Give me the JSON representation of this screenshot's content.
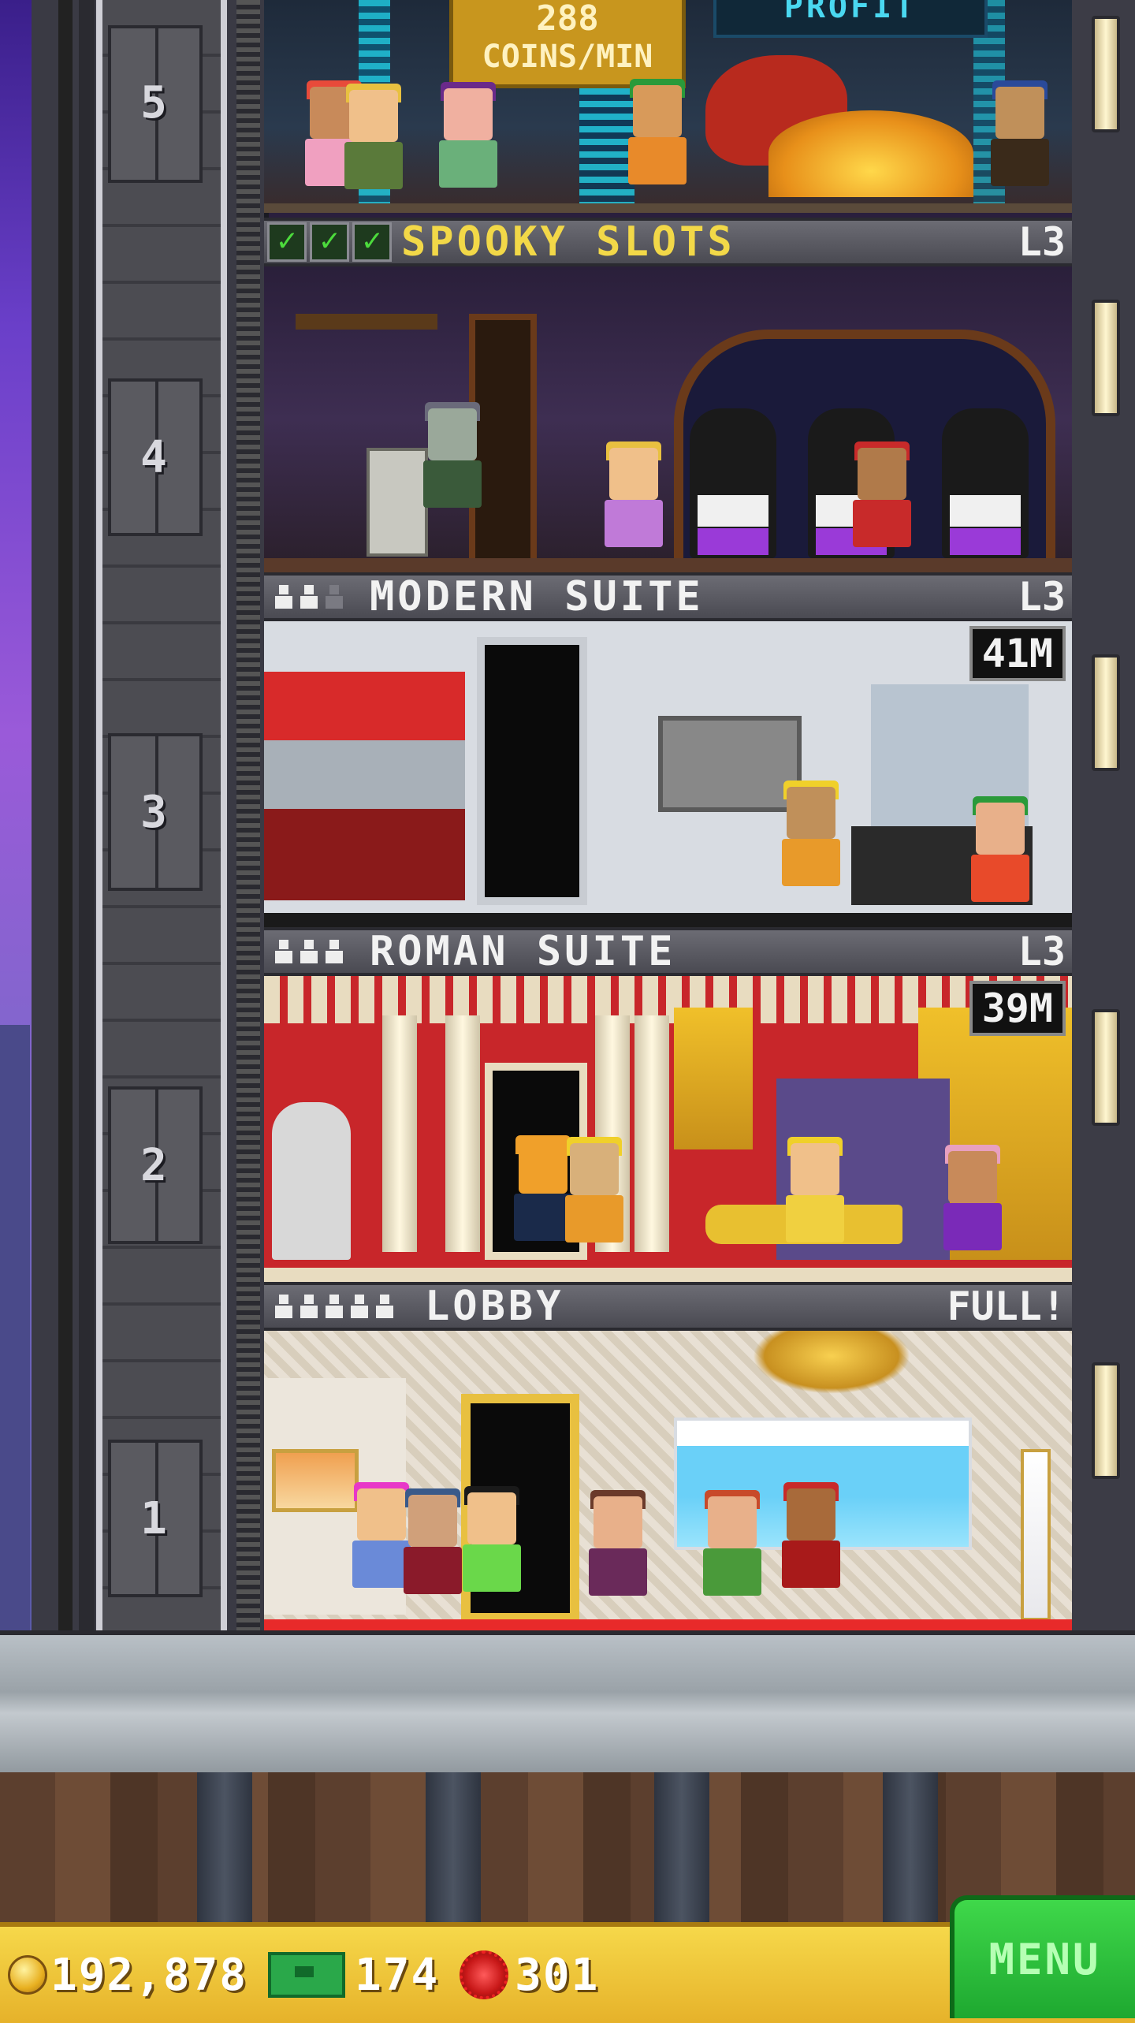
{
  "shaft": {
    "floor_numbers": [
      "5",
      "4",
      "3",
      "2",
      "1"
    ]
  },
  "floors": [
    {
      "key": "top",
      "coins_label_value": "288",
      "coins_label_unit": "COINS/MIN",
      "sign_partial": "PROFIT",
      "theme": "casino"
    },
    {
      "key": "spooky",
      "title": "SPOOKY SLOTS",
      "level": "L3",
      "checks": 3,
      "theme": "haunted-casino"
    },
    {
      "key": "modern",
      "title": "MODERN SUITE",
      "level": "L3",
      "residents_filled": 2,
      "residents_total": 3,
      "timer": "41M"
    },
    {
      "key": "roman",
      "title": "ROMAN SUITE",
      "level": "L3",
      "residents_filled": 3,
      "residents_total": 3,
      "timer": "39M"
    },
    {
      "key": "lobby",
      "title": "LOBBY",
      "status": "FULL!",
      "residents_filled": 5,
      "residents_total": 5
    }
  ],
  "hud": {
    "coins": "192,878",
    "bux": "174",
    "gems": "301",
    "menu_label": "MENU"
  },
  "colors": {
    "hud_bg": "#f2c838",
    "menu_green": "#2ac83a",
    "header_gold": "#f2d848"
  }
}
